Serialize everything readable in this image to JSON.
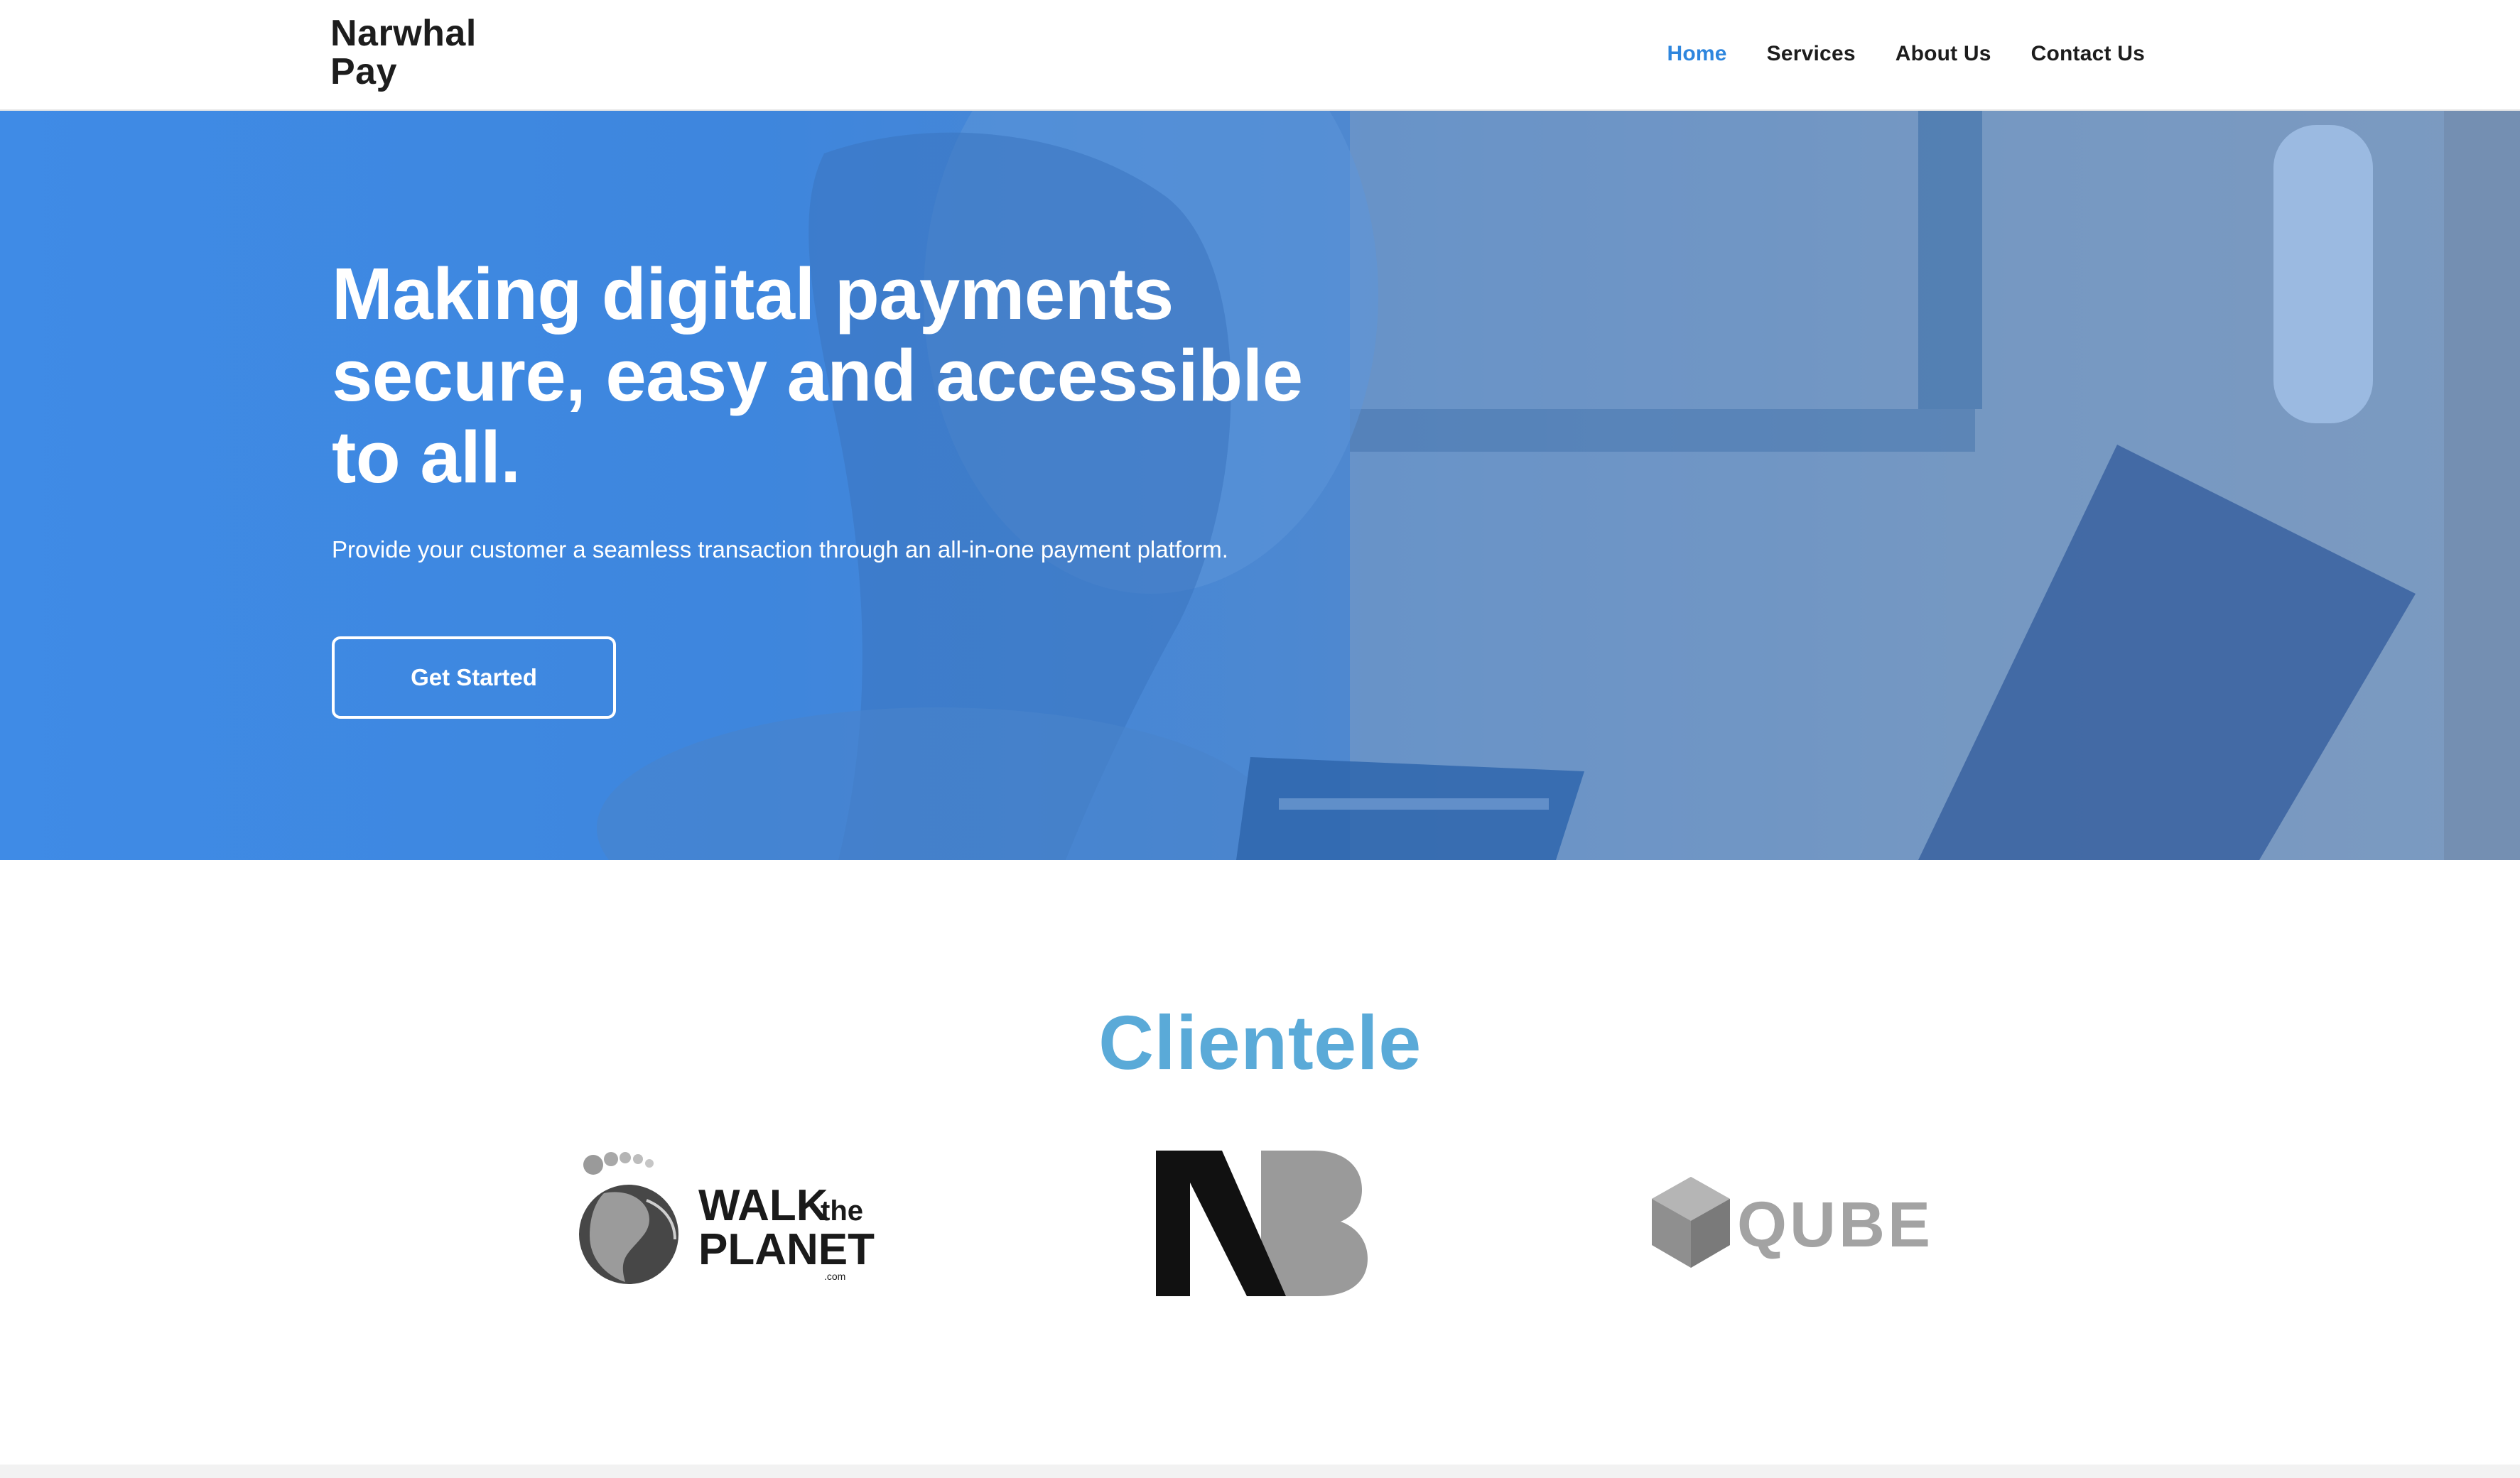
{
  "brand": {
    "name_line1": "Narwhal",
    "name_line2": "Pay"
  },
  "nav": {
    "items": [
      {
        "label": "Home",
        "active": true
      },
      {
        "label": "Services",
        "active": false
      },
      {
        "label": "About Us",
        "active": false
      },
      {
        "label": "Contact Us",
        "active": false
      }
    ]
  },
  "hero": {
    "title": "Making digital payments secure, easy and accessible to all.",
    "subtitle": "Provide your customer a seamless transaction through an all-in-one payment platform.",
    "cta_label": "Get Started"
  },
  "clientele": {
    "title": "Clientele",
    "logos": [
      {
        "name": "WALK the PLANET",
        "line1": "WALK",
        "line1b": "the",
        "line2": "PLANET",
        "line3": ".com"
      },
      {
        "name": "NB",
        "text": "NB"
      },
      {
        "name": "QUBE",
        "text": "QUBE"
      }
    ]
  },
  "colors": {
    "accent": "#2e86de",
    "hero_blue": "#3f8be6",
    "clientele_title": "#5aaad8",
    "text_dark": "#1d1d1d"
  }
}
